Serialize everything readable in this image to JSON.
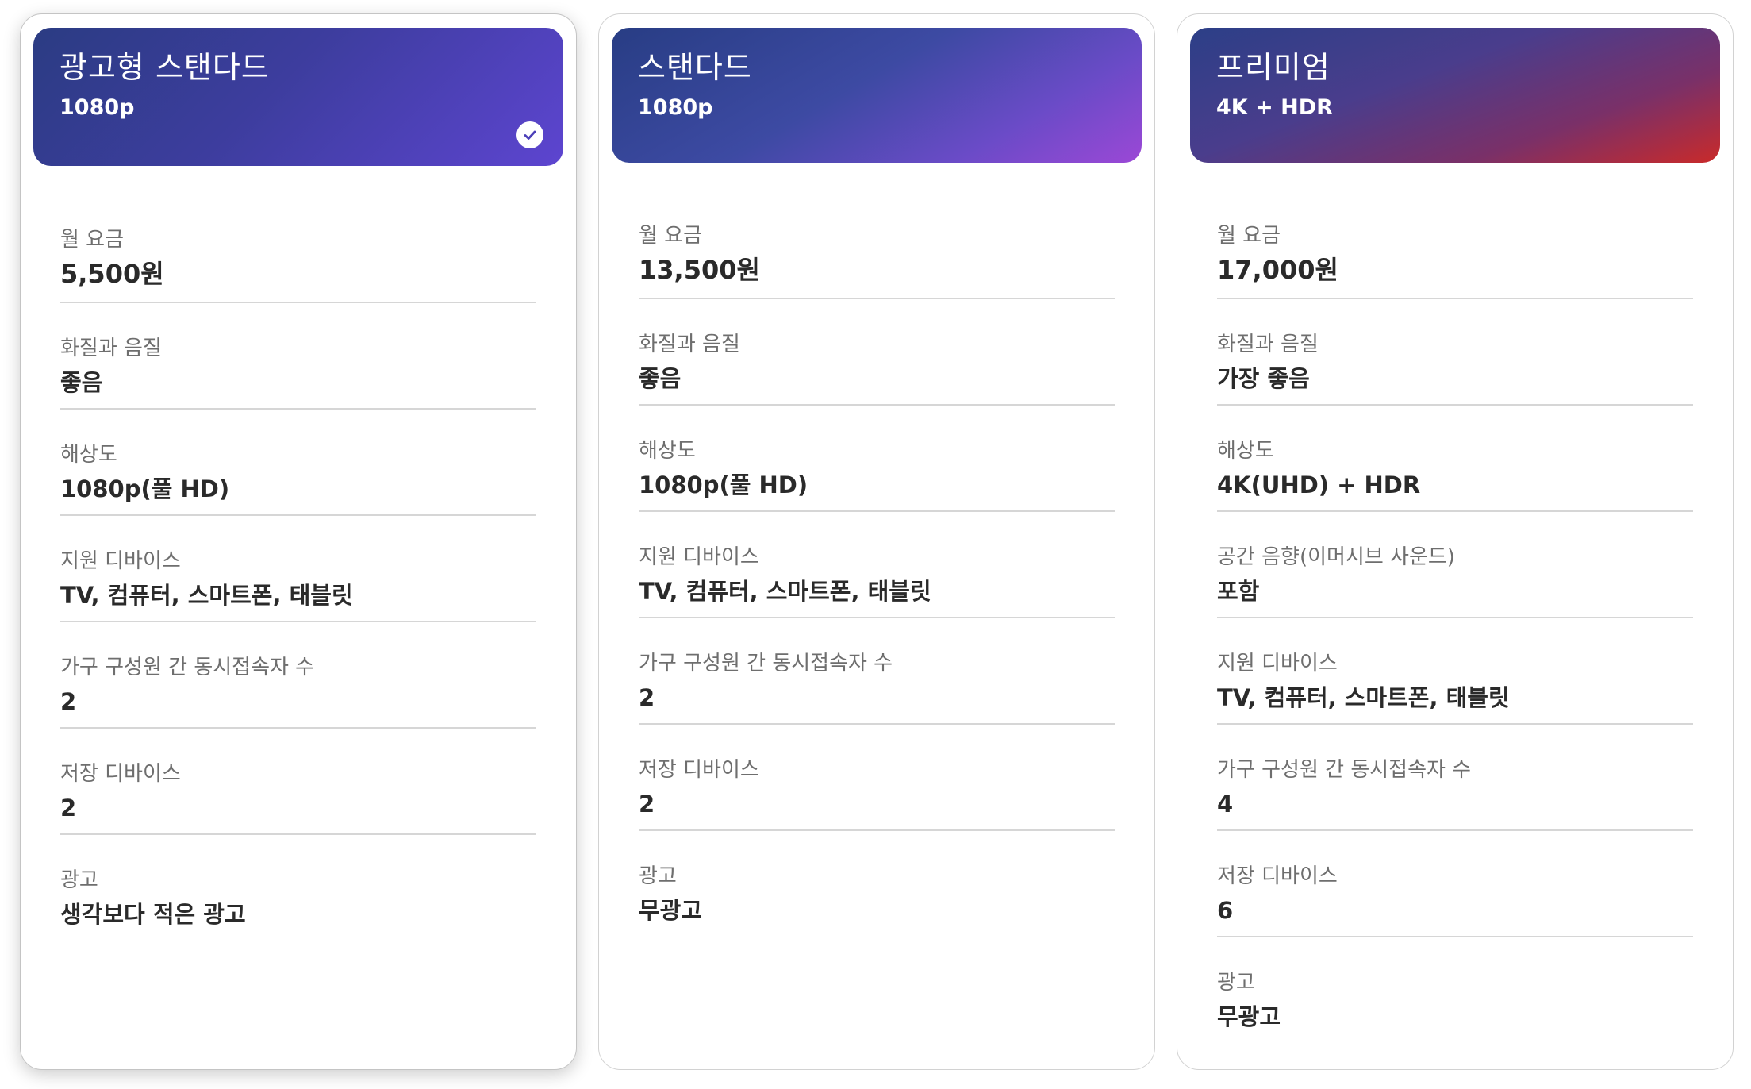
{
  "plans": [
    {
      "name": "광고형 스탠다드",
      "resolution_tag": "1080p",
      "selected": true,
      "rows": [
        {
          "label": "월 요금",
          "value": "5,500원"
        },
        {
          "label": "화질과 음질",
          "value": "좋음"
        },
        {
          "label": "해상도",
          "value": "1080p(풀 HD)"
        },
        {
          "label": "지원 디바이스",
          "value": "TV, 컴퓨터, 스마트폰, 태블릿"
        },
        {
          "label": "가구 구성원 간 동시접속자 수",
          "value": "2"
        },
        {
          "label": "저장 디바이스",
          "value": "2"
        },
        {
          "label": "광고",
          "value": "생각보다 적은 광고"
        }
      ]
    },
    {
      "name": "스탠다드",
      "resolution_tag": "1080p",
      "selected": false,
      "rows": [
        {
          "label": "월 요금",
          "value": "13,500원"
        },
        {
          "label": "화질과 음질",
          "value": "좋음"
        },
        {
          "label": "해상도",
          "value": "1080p(풀 HD)"
        },
        {
          "label": "지원 디바이스",
          "value": "TV, 컴퓨터, 스마트폰, 태블릿"
        },
        {
          "label": "가구 구성원 간 동시접속자 수",
          "value": "2"
        },
        {
          "label": "저장 디바이스",
          "value": "2"
        },
        {
          "label": "광고",
          "value": "무광고"
        }
      ]
    },
    {
      "name": "프리미엄",
      "resolution_tag": "4K + HDR",
      "selected": false,
      "rows": [
        {
          "label": "월 요금",
          "value": "17,000원"
        },
        {
          "label": "화질과 음질",
          "value": "가장 좋음"
        },
        {
          "label": "해상도",
          "value": "4K(UHD) + HDR"
        },
        {
          "label": "공간 음향(이머시브 사운드)",
          "value": "포함"
        },
        {
          "label": "지원 디바이스",
          "value": "TV, 컴퓨터, 스마트폰, 태블릿"
        },
        {
          "label": "가구 구성원 간 동시접속자 수",
          "value": "4"
        },
        {
          "label": "저장 디바이스",
          "value": "6"
        },
        {
          "label": "광고",
          "value": "무광고"
        }
      ]
    }
  ],
  "icons": {
    "selected_check": "checkmark-circle-icon"
  },
  "colors": {
    "check_fill": "#4b3fb8"
  }
}
